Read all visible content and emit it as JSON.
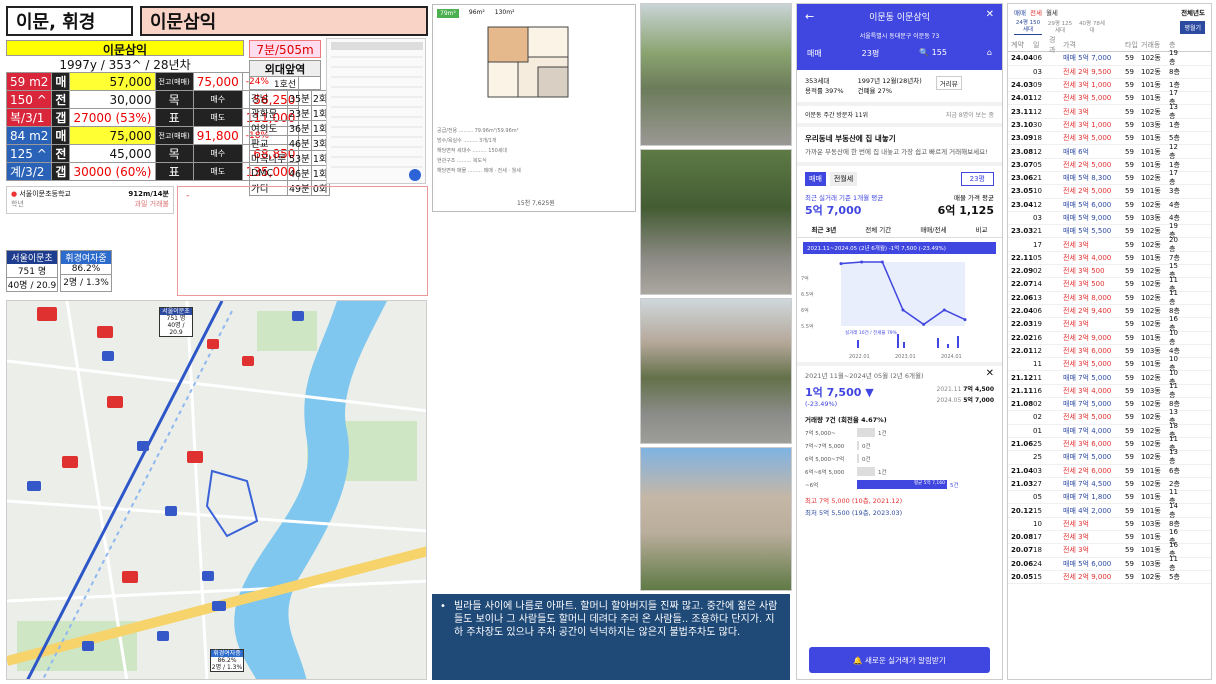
{
  "header": {
    "left_title": "이문, 휘경",
    "right_title": "이문삼익"
  },
  "summary": {
    "name": "이문삼익",
    "sub": "1997y / 353^ / 28년차",
    "walk": "7분/505m",
    "rows": [
      {
        "size": "59 m2",
        "kind": "매",
        "price": "57,000",
        "tag": "전고(매매)",
        "high": "75,000",
        "pct": "-24%"
      },
      {
        "size": "150 ^",
        "kind": "전",
        "price": "30,000",
        "tag": "목",
        "sub_label": "매수",
        "sub_val": "56,250"
      },
      {
        "size": "복/3/1",
        "kind": "갭",
        "price": "27000 (53%)",
        "tag": "표",
        "sub_label": "매도",
        "sub_val": "111,000"
      },
      {
        "size": "84 m2",
        "kind": "매",
        "price": "75,000",
        "tag": "전고(매매)",
        "high": "91,800",
        "pct": "-18%"
      },
      {
        "size": "125 ^",
        "kind": "전",
        "price": "45,000",
        "tag": "목",
        "sub_label": "매수",
        "sub_val": "68,850"
      },
      {
        "size": "계/3/2",
        "kind": "갭",
        "price": "30000 (60%)",
        "tag": "표",
        "sub_label": "매도",
        "sub_val": "135,000"
      }
    ]
  },
  "commute": {
    "title": "외대앞역",
    "line": "1호선",
    "rows": [
      {
        "dest": "강남",
        "min": "35분",
        "transfer": "2회"
      },
      {
        "dest": "광화문",
        "min": "23분",
        "transfer": "1회"
      },
      {
        "dest": "여의도",
        "min": "36분",
        "transfer": "1회"
      },
      {
        "dest": "판교",
        "min": "46분",
        "transfer": "3회"
      },
      {
        "dest": "마곡나루",
        "min": "53분",
        "transfer": "1회"
      },
      {
        "dest": "DMC",
        "min": "46분",
        "transfer": "1회"
      },
      {
        "dest": "가디",
        "min": "49분",
        "transfer": "0회"
      }
    ]
  },
  "school": {
    "name": "서울이문초등학교",
    "dist": "912m/14분",
    "kind": "학년",
    "note": "과밀 거래불"
  },
  "school_stats": [
    {
      "name": "서울이문초",
      "value": "751 명",
      "ratio": "40명 / 20.9"
    },
    {
      "name": "휘경여자중",
      "value": "86.2%",
      "ratio": "2명 / 1.3%"
    }
  ],
  "floorplan": {
    "tabs": [
      "79m²",
      "96m²",
      "130m²"
    ],
    "footer": "15천 7,625원"
  },
  "map": {
    "labels": {
      "school_a": "서울이문초",
      "school_a_val": "751 명",
      "school_a_ratio": "40명 / 20.9",
      "school_b": "휘경여자중",
      "school_b_val": "86.2%",
      "school_b_ratio": "2명 / 1.3%"
    }
  },
  "note": {
    "text": "빌라들 사이에 나름로 아파트. 할머니 할아버지들 진짜 많고. 중간에 젊은 사람들도 보이나 그 사람들도 할머니 데려다 주러 온 사람들.. 조용하다 단지가. 지하 주차장도 있으나 주차 공간이 넉넉하지는 않은지 불법주차도 많다."
  },
  "phone": {
    "title": "이문동 이문삼익",
    "address": "서울특별시 동대문구 이문동 73",
    "tabs": {
      "trade": "매매",
      "size": "23평",
      "comments": "155"
    },
    "info1": "353세대",
    "info2": "용적률 397%",
    "info3": "1997년 12월(28년차)",
    "info4": "건폐율 27%",
    "review": "거리뷰",
    "visitors": "이문동 주간 방문자 11위",
    "visitors_more": "지금 8명이 보는 중",
    "promo_title": "우리동네 부동산에 집 내놓기",
    "promo_body": "가까운 부동산에 한 번에 집 내놓고 가장 쉽고 빠르게 거래해보세요!",
    "seg1": "매매",
    "seg2": "전월세",
    "seg_size": "23평",
    "recent_label": "최근 실거래 기준 1개월 평균",
    "recent_price": "5억 7,000",
    "ask_label": "매물 가격 평균",
    "ask_price": "6억 1,125",
    "chart_tabs": [
      "최근 3년",
      "전체 기간",
      "매매/전세",
      "비교"
    ],
    "chart_banner": "2021.11~2024.05 (2년 6개월) -1억 7,500 (-23.49%)",
    "period": "2021년 11월~2024년 05월 (2년 6개월)",
    "delta": "1억 7,500 ▼",
    "delta_pct": "(-23.49%)",
    "from_date": "2021.11",
    "from_val": "7억 4,500",
    "to_date": "2024.05",
    "to_val": "5억 7,000",
    "volume": "거래량 7건 (회전율 4.67%)",
    "hist": [
      {
        "range": "7억 5,000~",
        "count": "1건"
      },
      {
        "range": "7억~7억 5,000",
        "count": "0건"
      },
      {
        "range": "6억 5,000~7억",
        "count": "0건"
      },
      {
        "range": "6억~6억 5,000",
        "count": "1건"
      },
      {
        "range": "~6억",
        "count": "5건"
      }
    ],
    "hist_avg": "평균 5억 7,160",
    "max": "최고 7억 5,000 (10층, 2021.12)",
    "min": "최저 5억 5,500 (19층, 2023.03)",
    "alert": "새로운 실거래가 알림받기"
  },
  "chart_data": {
    "type": "line",
    "title": "2021.11~2024.05 (2년 6개월) -1억 7,500 (-23.49%)",
    "x": [
      "2021.11",
      "2022.01",
      "2022.12",
      "2023.01",
      "2023.03",
      "2024.01",
      "2024.05"
    ],
    "series": [
      {
        "name": "실거래 10건 / 전세율 79%",
        "values": [
          7.45,
          7.5,
          7.5,
          6.0,
          5.55,
          6.0,
          5.7
        ]
      }
    ],
    "ylabel": "",
    "yticks": [
      "7억",
      "6.5억",
      "6억",
      "5.5억"
    ],
    "xticks": [
      "2022.01",
      "2023.01",
      "2024.01"
    ]
  },
  "tx_panel": {
    "tabs": [
      "매매",
      "전세",
      "월세"
    ],
    "range": "전체년도",
    "sizes": [
      "24평 150세대",
      "29평 125세대",
      "40평 78세대"
    ],
    "btn": "평월기",
    "headers": [
      "계약",
      "일",
      "경과",
      "가격",
      "타입",
      "거래동",
      "층"
    ],
    "rows": [
      {
        "ym": "24.04",
        "d": "06",
        "p": "매매 5억 7,000",
        "t": "59",
        "b": "102동",
        "f": "19층",
        "kind": "sale"
      },
      {
        "ym": "",
        "d": "03",
        "p": "전세 2억 9,500",
        "t": "59",
        "b": "102동",
        "f": "8층",
        "kind": "rent"
      },
      {
        "ym": "24.03",
        "d": "09",
        "p": "전세 3억 1,000",
        "t": "59",
        "b": "101동",
        "f": "1층",
        "kind": "rent"
      },
      {
        "ym": "24.01",
        "d": "12",
        "p": "전세 3억 5,000",
        "t": "59",
        "b": "101동",
        "f": "17층",
        "kind": "rent"
      },
      {
        "ym": "23.11",
        "d": "12",
        "p": "전세 3억",
        "t": "59",
        "b": "102동",
        "f": "13층",
        "kind": "rent"
      },
      {
        "ym": "23.10",
        "d": "30",
        "p": "전세 3억 1,000",
        "t": "59",
        "b": "103동",
        "f": "1층",
        "kind": "rent"
      },
      {
        "ym": "23.09",
        "d": "18",
        "p": "전세 3억 5,000",
        "t": "59",
        "b": "101동",
        "f": "5층",
        "kind": "rent"
      },
      {
        "ym": "23.08",
        "d": "12",
        "p": "매매 6억",
        "t": "59",
        "b": "101동",
        "f": "12층",
        "kind": "sale"
      },
      {
        "ym": "23.07",
        "d": "05",
        "p": "전세 2억 5,000",
        "t": "59",
        "b": "101동",
        "f": "1층",
        "kind": "rent"
      },
      {
        "ym": "23.06",
        "d": "21",
        "p": "매매 5억 8,300",
        "t": "59",
        "b": "102동",
        "f": "17층",
        "kind": "sale"
      },
      {
        "ym": "23.05",
        "d": "10",
        "p": "전세 2억 5,000",
        "t": "59",
        "b": "101동",
        "f": "3층",
        "kind": "rent"
      },
      {
        "ym": "23.04",
        "d": "12",
        "p": "매매 5억 6,000",
        "t": "59",
        "b": "102동",
        "f": "4층",
        "kind": "sale"
      },
      {
        "ym": "",
        "d": "03",
        "p": "매매 5억 9,000",
        "t": "59",
        "b": "103동",
        "f": "4층",
        "kind": "sale"
      },
      {
        "ym": "23.03",
        "d": "21",
        "p": "매매 5억 5,500",
        "t": "59",
        "b": "102동",
        "f": "19층",
        "kind": "sale"
      },
      {
        "ym": "",
        "d": "17",
        "p": "전세 3억",
        "t": "59",
        "b": "102동",
        "f": "20층",
        "kind": "rent"
      },
      {
        "ym": "22.11",
        "d": "05",
        "p": "전세 3억 4,000",
        "t": "59",
        "b": "101동",
        "f": "7층",
        "kind": "rent"
      },
      {
        "ym": "22.09",
        "d": "02",
        "p": "전세 3억 500",
        "t": "59",
        "b": "102동",
        "f": "15층",
        "kind": "rent"
      },
      {
        "ym": "22.07",
        "d": "14",
        "p": "전세 3억 500",
        "t": "59",
        "b": "102동",
        "f": "11층",
        "kind": "rent"
      },
      {
        "ym": "22.06",
        "d": "13",
        "p": "전세 3억 8,000",
        "t": "59",
        "b": "102동",
        "f": "11층",
        "kind": "rent"
      },
      {
        "ym": "22.04",
        "d": "06",
        "p": "전세 2억 9,400",
        "t": "59",
        "b": "102동",
        "f": "8층",
        "kind": "rent"
      },
      {
        "ym": "22.03",
        "d": "19",
        "p": "전세 3억",
        "t": "59",
        "b": "102동",
        "f": "16층",
        "kind": "rent"
      },
      {
        "ym": "22.02",
        "d": "16",
        "p": "전세 2억 9,000",
        "t": "59",
        "b": "101동",
        "f": "10층",
        "kind": "rent"
      },
      {
        "ym": "22.01",
        "d": "12",
        "p": "전세 3억 6,000",
        "t": "59",
        "b": "103동",
        "f": "4층",
        "kind": "rent"
      },
      {
        "ym": "",
        "d": "11",
        "p": "전세 3억 5,000",
        "t": "59",
        "b": "101동",
        "f": "10층",
        "kind": "rent"
      },
      {
        "ym": "21.12",
        "d": "11",
        "p": "매매 7억 5,000",
        "t": "59",
        "b": "102동",
        "f": "10층",
        "kind": "sale"
      },
      {
        "ym": "21.11",
        "d": "16",
        "p": "전세 3억 4,000",
        "t": "59",
        "b": "103동",
        "f": "11층",
        "kind": "rent"
      },
      {
        "ym": "21.08",
        "d": "02",
        "p": "매매 7억 5,000",
        "t": "59",
        "b": "102동",
        "f": "8층",
        "kind": "sale"
      },
      {
        "ym": "",
        "d": "02",
        "p": "전세 3억 5,000",
        "t": "59",
        "b": "102동",
        "f": "13층",
        "kind": "rent"
      },
      {
        "ym": "",
        "d": "01",
        "p": "매매 7억 4,000",
        "t": "59",
        "b": "102동",
        "f": "18층",
        "kind": "sale"
      },
      {
        "ym": "21.06",
        "d": "25",
        "p": "전세 3억 6,000",
        "t": "59",
        "b": "102동",
        "f": "11층",
        "kind": "rent"
      },
      {
        "ym": "",
        "d": "25",
        "p": "매매 7억 5,000",
        "t": "59",
        "b": "102동",
        "f": "13층",
        "kind": "sale"
      },
      {
        "ym": "21.04",
        "d": "03",
        "p": "전세 2억 6,000",
        "t": "59",
        "b": "101동",
        "f": "6층",
        "kind": "rent"
      },
      {
        "ym": "21.03",
        "d": "27",
        "p": "매매 7억 4,500",
        "t": "59",
        "b": "102동",
        "f": "2층",
        "kind": "sale"
      },
      {
        "ym": "",
        "d": "05",
        "p": "매매 7억 1,800",
        "t": "59",
        "b": "101동",
        "f": "11층",
        "kind": "sale"
      },
      {
        "ym": "20.12",
        "d": "15",
        "p": "매매 4억 2,000",
        "t": "59",
        "b": "101동",
        "f": "14층",
        "kind": "sale"
      },
      {
        "ym": "",
        "d": "10",
        "p": "전세 3억",
        "t": "59",
        "b": "103동",
        "f": "8층",
        "kind": "rent"
      },
      {
        "ym": "20.08",
        "d": "17",
        "p": "전세 3억",
        "t": "59",
        "b": "101동",
        "f": "16층",
        "kind": "rent"
      },
      {
        "ym": "20.07",
        "d": "18",
        "p": "전세 3억",
        "t": "59",
        "b": "101동",
        "f": "16층",
        "kind": "rent"
      },
      {
        "ym": "20.06",
        "d": "24",
        "p": "매매 5억 6,000",
        "t": "59",
        "b": "103동",
        "f": "11층",
        "kind": "sale"
      },
      {
        "ym": "20.05",
        "d": "15",
        "p": "전세 2억 9,000",
        "t": "59",
        "b": "102동",
        "f": "5층",
        "kind": "rent"
      }
    ]
  }
}
